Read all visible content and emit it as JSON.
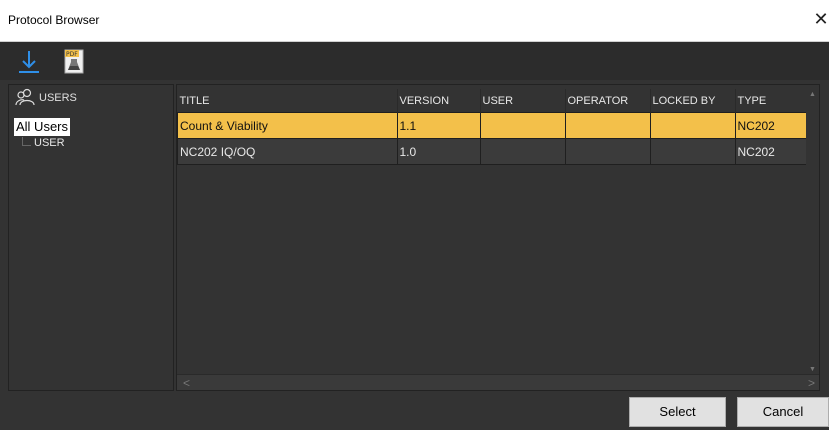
{
  "window": {
    "title": "Protocol Browser",
    "close_glyph": "✕"
  },
  "toolbar": {
    "icons": [
      "download-icon",
      "pdf-report-icon"
    ],
    "pdf_badge": "PDF"
  },
  "sidebar": {
    "header_label": "USERS",
    "header_icon": "users-icon",
    "selected_item": "All Users",
    "child_item": "USER"
  },
  "grid": {
    "columns": [
      "TITLE",
      "VERSION",
      "USER",
      "OPERATOR",
      "LOCKED BY",
      "TYPE"
    ],
    "rows": [
      {
        "title": "Count & Viability",
        "version": "1.1",
        "user": "",
        "operator": "",
        "locked_by": "",
        "type": "NC202",
        "selected": true
      },
      {
        "title": "NC202 IQ/OQ",
        "version": "1.0",
        "user": "",
        "operator": "",
        "locked_by": "",
        "type": "NC202",
        "selected": false
      }
    ],
    "scroll_left": "<",
    "scroll_right": ">",
    "scroll_up": "▲",
    "scroll_down": "▼"
  },
  "footer": {
    "select_label": "Select",
    "cancel_label": "Cancel"
  },
  "colors": {
    "selection": "#f3c04a",
    "background": "#333333",
    "accent_blue": "#2f8fe8"
  }
}
